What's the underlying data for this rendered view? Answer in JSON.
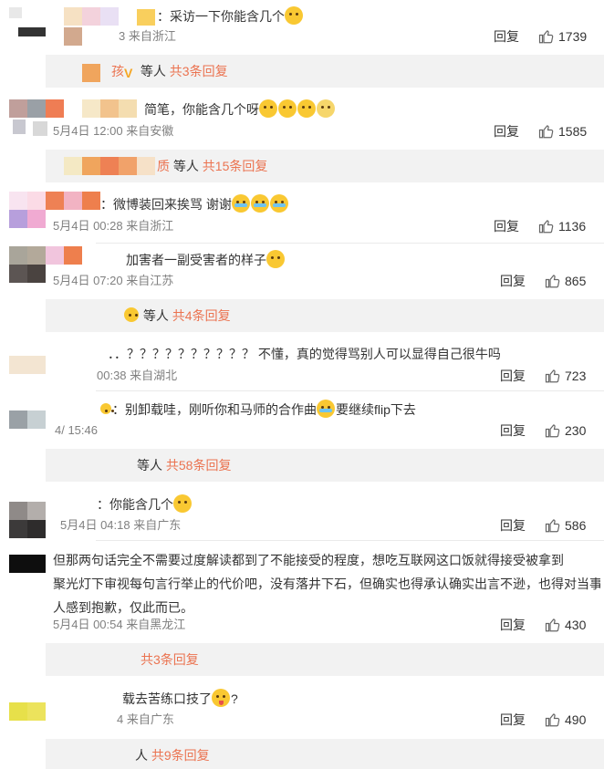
{
  "comments": [
    {
      "text": "：采访一下你能含几个",
      "meta": "3 来自浙江",
      "reply": "回复",
      "likes": "1739"
    },
    {
      "text": "简笔，你能含几个呀",
      "meta": "5月4日 12:00 来自安徽",
      "reply": "回复",
      "likes": "1585"
    },
    {
      "text": "：微博装回来挨骂 谢谢",
      "meta": "5月4日 00:28 来自浙江",
      "reply": "回复",
      "likes": "1136"
    },
    {
      "text": "加害者一副受害者的样子",
      "meta": "5月4日 07:20 来自江苏",
      "reply": "回复",
      "likes": "865"
    },
    {
      "text": "．．？？？？？？？？？？ 不懂，真的觉得骂别人可以显得自己很牛吗",
      "meta": "00:38 来自湖北",
      "reply": "回复",
      "likes": "723"
    },
    {
      "text": "：别卸载哇，刚听你和马师的合作曲",
      "text_tail": "要继续flip下去",
      "meta": "4/ 15:46",
      "reply": "回复",
      "likes": "230"
    },
    {
      "text": "：你能含几个",
      "meta": "5月4日 04:18 来自广东",
      "reply": "回复",
      "likes": "586"
    },
    {
      "text_lines": [
        "但那两句话完全不需要过度解读都到了不能接受的程度，想吃互联网这口饭就得接受被拿到",
        "聚光灯下审视每句言行举止的代价吧，没有落井下石，但确实也得承认确实出言不逊，也得对当事",
        "人感到抱歉，仅此而已。"
      ],
      "meta": "5月4日 00:54 来自黑龙江",
      "reply": "回复",
      "likes": "430"
    },
    {
      "text": "载去苦练口技了",
      "text_tail": "?",
      "meta": "4 来自广东",
      "reply": "回复",
      "likes": "490"
    }
  ],
  "subreplies": [
    {
      "prefix": "孩",
      "who": "等人",
      "count": "共3条回复"
    },
    {
      "prefix": "质",
      "who": "等人",
      "count": "共15条回复"
    },
    {
      "prefix": "",
      "who": "等人",
      "count": "共4条回复"
    },
    {
      "prefix": "",
      "who": "等人",
      "count": "共58条回复"
    },
    {
      "prefix": "",
      "who": "",
      "count": "共3条回复"
    },
    {
      "prefix": "",
      "who": "人",
      "count": "共9条回复"
    }
  ],
  "colors": {
    "accent": "#eb7350",
    "meta": "#808080",
    "subbg": "#f2f2f2"
  },
  "icons": {
    "like": "thumbs-up-icon",
    "verified": "v-badge-icon"
  }
}
